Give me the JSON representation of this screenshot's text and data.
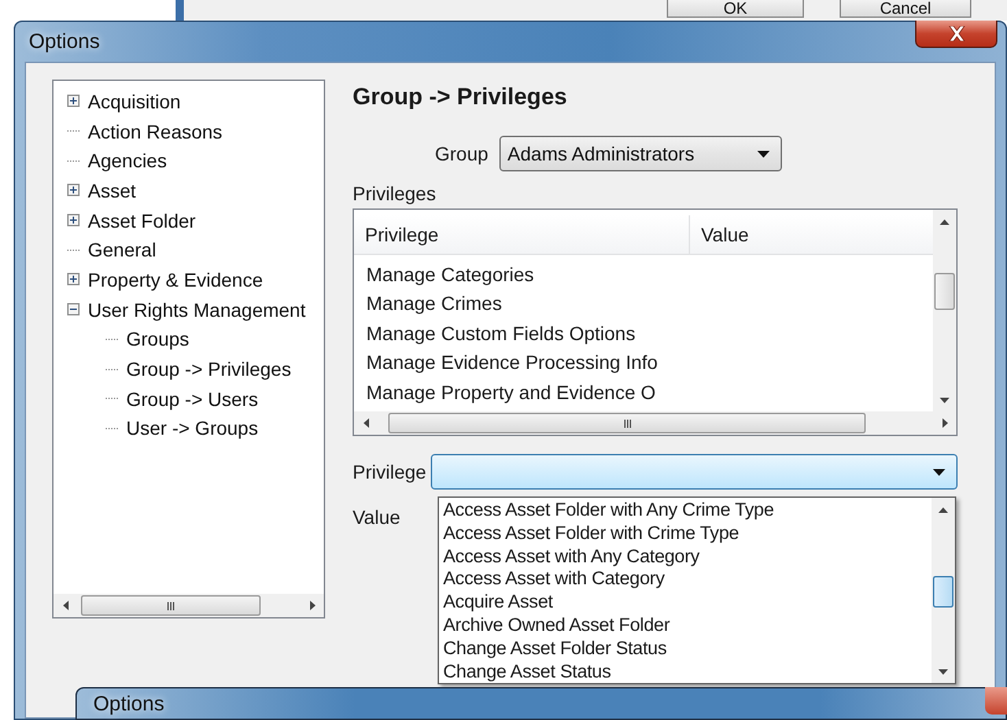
{
  "background_window": {
    "buttons": [
      "OK",
      "Cancel"
    ]
  },
  "window": {
    "title": "Options"
  },
  "tree": {
    "items": [
      {
        "label": "Acquisition",
        "expanded": false
      },
      {
        "label": "Action Reasons"
      },
      {
        "label": "Agencies"
      },
      {
        "label": "Asset",
        "expanded": false
      },
      {
        "label": "Asset Folder",
        "expanded": false
      },
      {
        "label": "General"
      },
      {
        "label": "Property & Evidence",
        "expanded": false
      },
      {
        "label": "User Rights Management",
        "expanded": true,
        "children": [
          {
            "label": "Groups"
          },
          {
            "label": "Group -> Privileges"
          },
          {
            "label": "Group -> Users"
          },
          {
            "label": "User -> Groups"
          }
        ]
      }
    ]
  },
  "heading": "Group -> Privileges",
  "group": {
    "label": "Group",
    "value": "Adams Administrators"
  },
  "privileges": {
    "label": "Privileges",
    "columns": [
      "Privilege",
      "Value"
    ],
    "rows": [
      {
        "privilege": "Manage Categories"
      },
      {
        "privilege": "Manage Crimes"
      },
      {
        "privilege": "Manage Custom Fields Options"
      },
      {
        "privilege": "Manage Evidence Processing Info"
      },
      {
        "privilege": "Manage Property and Evidence O"
      }
    ]
  },
  "privilege_select": {
    "label": "Privilege",
    "open": true,
    "options": [
      "Access Asset Folder with Any Crime Type",
      "Access Asset Folder with Crime Type",
      "Access Asset with Any Category",
      "Access Asset with Category",
      "Acquire Asset",
      "Archive Owned Asset Folder",
      "Change Asset Folder Status",
      "Change Asset Status"
    ]
  },
  "value_label": "Value",
  "front_window": {
    "title": "Options"
  }
}
